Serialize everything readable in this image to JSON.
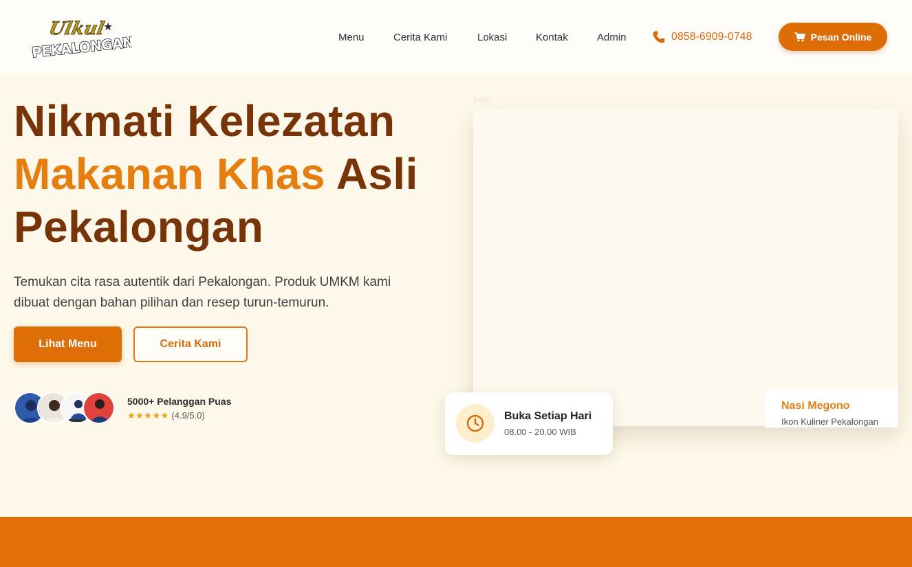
{
  "brand": {
    "logo_script": "Ulkul",
    "logo_word": "PEKALONGAN",
    "logo_star": "★"
  },
  "nav": {
    "links": [
      "Menu",
      "Cerita Kami",
      "Lokasi",
      "Kontak",
      "Admin"
    ],
    "phone": "0858-6909-0748",
    "order_button": "Pesan Online"
  },
  "hero": {
    "title_line1": "Nikmati Kelezatan",
    "title_accent": "Makanan Khas",
    "title_line2_rest": " Asli",
    "title_line3": "Pekalongan",
    "description": "Temukan cita rasa autentik dari Pekalongan. Produk UMKM kami dibuat dengan bahan pilihan dan resep turun-temurun.",
    "primary_button": "Lihat Menu",
    "secondary_button": "Cerita Kami",
    "customers": "5000+ Pelanggan Puas",
    "stars": "★★★★★",
    "rating": "(4.9/5.0)",
    "image_alt": "helo"
  },
  "hours_card": {
    "title": "Buka Setiap Hari",
    "time": "08.00 - 20.00 WIB"
  },
  "dish_card": {
    "name": "Nasi Megono",
    "subtitle": "Ikon Kuliner Pekalongan"
  },
  "colors": {
    "primary": "#de6f07",
    "accent_text": "#e57d0f",
    "title_brown": "#763408",
    "hero_bg": "#fdf8e9",
    "band": "#e2700a"
  },
  "icons": [
    "phone-icon",
    "cart-icon",
    "clock-icon",
    "star-icon"
  ]
}
